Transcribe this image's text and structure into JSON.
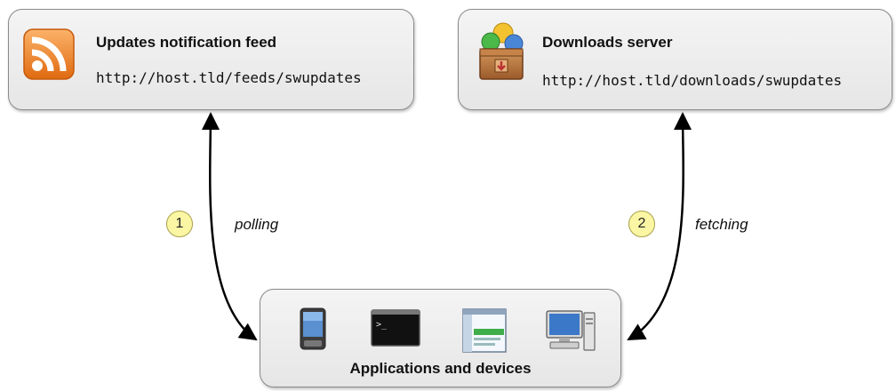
{
  "nodes": {
    "feed": {
      "title": "Updates notification feed",
      "url": "http://host.tld/feeds/swupdates",
      "icon": "rss-feed-icon"
    },
    "downloads": {
      "title": "Downloads server",
      "url": "http://host.tld/downloads/swupdates",
      "icon": "package-box-icon"
    },
    "apps": {
      "title": "Applications and devices",
      "icons": [
        "mobile-device-icon",
        "terminal-icon",
        "application-window-icon",
        "desktop-computer-icon"
      ]
    }
  },
  "edges": [
    {
      "from": "apps",
      "to": "feed",
      "step": "1",
      "label": "polling"
    },
    {
      "from": "apps",
      "to": "downloads",
      "step": "2",
      "label": "fetching"
    }
  ],
  "colors": {
    "box_border": "#8a8a8a",
    "box_fill": "#eeeeee",
    "step_badge": "#fbf6a4",
    "rss_orange": "#f18a23",
    "arrow": "#000000"
  }
}
